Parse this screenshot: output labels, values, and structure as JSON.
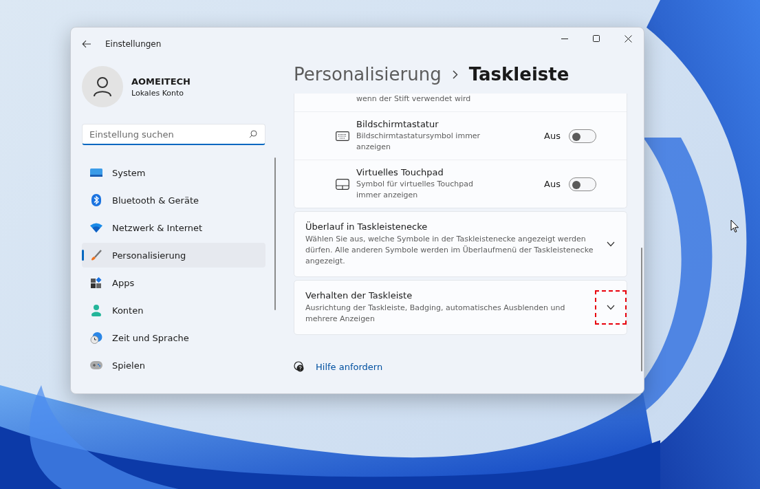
{
  "window": {
    "title": "Einstellungen"
  },
  "account": {
    "name": "AOMEITECH",
    "type": "Lokales Konto"
  },
  "search": {
    "placeholder": "Einstellung suchen"
  },
  "nav": [
    {
      "label": "System",
      "kind": "system",
      "selected": false
    },
    {
      "label": "Bluetooth & Geräte",
      "kind": "bluetooth",
      "selected": false
    },
    {
      "label": "Netzwerk & Internet",
      "kind": "network",
      "selected": false
    },
    {
      "label": "Personalisierung",
      "kind": "brush",
      "selected": true
    },
    {
      "label": "Apps",
      "kind": "apps",
      "selected": false
    },
    {
      "label": "Konten",
      "kind": "account",
      "selected": false
    },
    {
      "label": "Zeit und Sprache",
      "kind": "time",
      "selected": false
    },
    {
      "label": "Spielen",
      "kind": "gaming",
      "selected": false
    }
  ],
  "breadcrumb": {
    "parent": "Personalisierung",
    "current": "Taskleiste"
  },
  "settings": [
    {
      "kind": "partial",
      "description": "wenn der Stift verwendet wird"
    },
    {
      "kind": "keyboard",
      "title": "Bildschirmtastatur",
      "description": "Bildschirmtastatursymbol immer anzeigen",
      "reading": "Aus",
      "on": false
    },
    {
      "kind": "touchpad",
      "title": "Virtuelles Touchpad",
      "description": "Symbol für virtuelles Touchpad immer anzeigen",
      "reading": "Aus",
      "on": false
    }
  ],
  "sections": [
    {
      "title": "Überlauf in Taskleistenecke",
      "description": "Wählen Sie aus, welche Symbole in der Taskleistenecke angezeigt werden dürfen. Alle anderen Symbole werden im Überlaufmenü der Taskleistenecke angezeigt.",
      "expanded": false,
      "highlighted": false
    },
    {
      "title": "Verhalten der Taskleiste",
      "description": "Ausrichtung der Taskleiste, Badging, automatisches Ausblenden und mehrere Anzeigen",
      "expanded": false,
      "highlighted": true
    }
  ],
  "links": [
    {
      "label": "Hilfe anfordern"
    }
  ]
}
